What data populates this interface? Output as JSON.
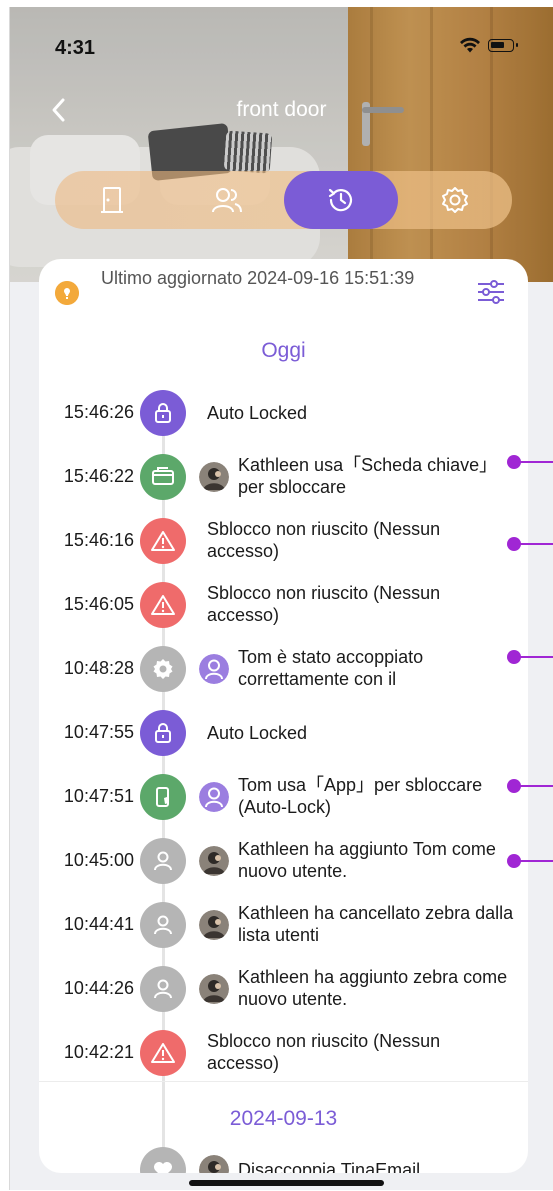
{
  "status_bar": {
    "time": "4:31"
  },
  "header": {
    "title": "front door"
  },
  "tabs": [
    "door",
    "users",
    "history",
    "settings"
  ],
  "update": {
    "text": "Ultimo aggiornato 2024-09-16 15:51:39"
  },
  "sections": {
    "today": "Oggi",
    "older": "2024-09-13"
  },
  "events": [
    {
      "time": "15:46:26",
      "icon": "lock-icon",
      "color": "#7b5cd6",
      "avatar": "",
      "text": "Auto Locked"
    },
    {
      "time": "15:46:22",
      "icon": "card-icon",
      "color": "#5ca86a",
      "avatar": "photo",
      "text": "Kathleen  usa「Scheda chiave」per sbloccare"
    },
    {
      "time": "15:46:16",
      "icon": "warning-icon",
      "color": "#ef6b6b",
      "avatar": "",
      "text": "Sblocco non riuscito (Nessun accesso)"
    },
    {
      "time": "15:46:05",
      "icon": "warning-icon",
      "color": "#ef6b6b",
      "avatar": "",
      "text": "Sblocco non riuscito (Nessun accesso)"
    },
    {
      "time": "10:48:28",
      "icon": "gear-icon",
      "color": "#b5b5b5",
      "avatar": "purple",
      "text": "Tom è stato accoppiato correttamente con il"
    },
    {
      "time": "10:47:55",
      "icon": "lock-icon",
      "color": "#7b5cd6",
      "avatar": "",
      "text": "Auto Locked"
    },
    {
      "time": "10:47:51",
      "icon": "phone-icon",
      "color": "#5ca86a",
      "avatar": "purple",
      "text": "Tom usa「App」per sbloccare (Auto-Lock)"
    },
    {
      "time": "10:45:00",
      "icon": "user-icon",
      "color": "#b5b5b5",
      "avatar": "photo",
      "text": "Kathleen  ha aggiunto Tom come nuovo utente."
    },
    {
      "time": "10:44:41",
      "icon": "user-icon",
      "color": "#b5b5b5",
      "avatar": "photo",
      "text": "Kathleen  ha cancellato zebra dalla lista utenti"
    },
    {
      "time": "10:44:26",
      "icon": "user-icon",
      "color": "#b5b5b5",
      "avatar": "photo",
      "text": "Kathleen  ha aggiunto zebra come nuovo utente."
    },
    {
      "time": "10:42:21",
      "icon": "warning-icon",
      "color": "#ef6b6b",
      "avatar": "",
      "text": "Sblocco non riuscito (Nessun accesso)"
    }
  ],
  "older_events": [
    {
      "time": "",
      "icon": "heart-icon",
      "color": "#b5b5b5",
      "avatar": "photo",
      "text": "Disaccoppia TinaEmail"
    }
  ],
  "colors": {
    "accent": "#7b5cd6",
    "success": "#5ca86a",
    "error": "#ef6b6b",
    "neutral": "#b5b5b5",
    "annotation": "#a026d4"
  }
}
